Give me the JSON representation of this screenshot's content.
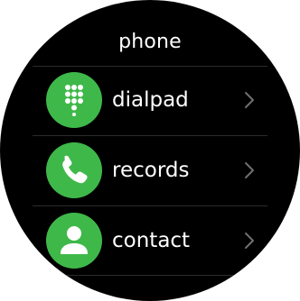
{
  "header": {
    "title": "phone"
  },
  "menu": {
    "items": [
      {
        "label": "dialpad",
        "icon": "dialpad-icon"
      },
      {
        "label": "records",
        "icon": "phone-handset-icon"
      },
      {
        "label": "contact",
        "icon": "person-icon"
      }
    ]
  },
  "colors": {
    "background": "#000000",
    "accent": "#3fb84a",
    "text": "#ffffff",
    "chevron": "#6f6f6f",
    "divider": "#2b2b2b"
  }
}
